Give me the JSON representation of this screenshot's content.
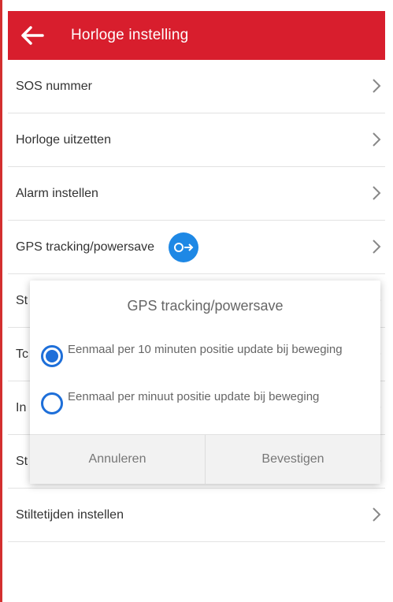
{
  "header": {
    "title": "Horloge instelling"
  },
  "list": {
    "items": [
      {
        "label": "SOS nummer"
      },
      {
        "label": "Horloge uitzetten"
      },
      {
        "label": "Alarm instellen"
      },
      {
        "label": "GPS tracking/powersave"
      },
      {
        "label": "St"
      },
      {
        "label": "Tc"
      },
      {
        "label": "In"
      },
      {
        "label": "St"
      },
      {
        "label": "Stiltetijden instellen"
      }
    ]
  },
  "dialog": {
    "title": "GPS tracking/powersave",
    "options": [
      {
        "label": "Eenmaal per 10 minuten positie update bij beweging",
        "selected": true
      },
      {
        "label": "Eenmaal per minuut positie update bij beweging",
        "selected": false
      }
    ],
    "cancel_label": "Annuleren",
    "confirm_label": "Bevestigen"
  },
  "colors": {
    "header_red": "#d81e2d",
    "radio_blue": "#1e6fd9",
    "badge_blue": "#1e88e5"
  }
}
